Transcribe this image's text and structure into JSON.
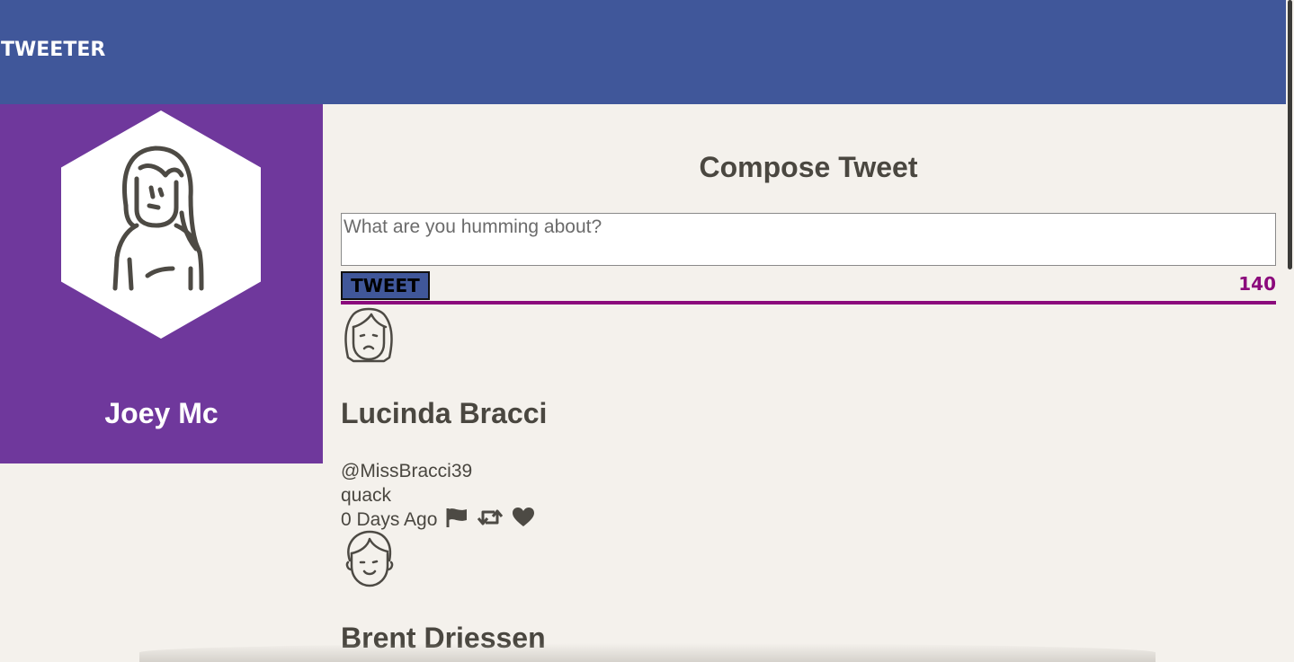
{
  "header": {
    "brand": "TWEETER",
    "background": "#40579a"
  },
  "profile": {
    "name": "Joey Mc",
    "avatar_icon": "woman-avatar-icon",
    "background": "#6f389c"
  },
  "compose": {
    "title": "Compose Tweet",
    "placeholder": "What are you humming about?",
    "button_label": "TWEET",
    "counter": "140",
    "accent": "#8b0a7c"
  },
  "tweets": [
    {
      "name": "Lucinda Bracci",
      "handle": "@MissBracci39",
      "content": "quack",
      "time": "0 Days Ago",
      "avatar_icon": "woman-face-icon",
      "actions": [
        "flag-icon",
        "retweet-icon",
        "heart-icon"
      ]
    },
    {
      "name": "Brent Driessen",
      "avatar_icon": "man-face-icon"
    }
  ]
}
